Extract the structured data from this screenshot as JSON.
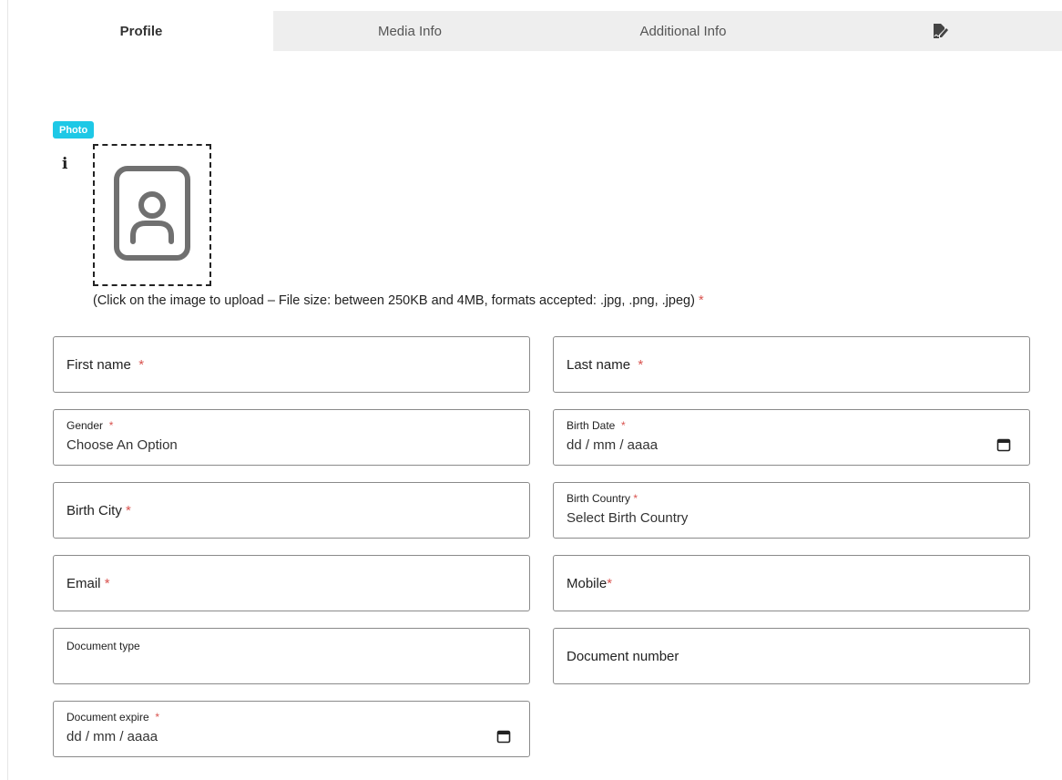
{
  "tabs": [
    {
      "label": "Profile",
      "active": true
    },
    {
      "label": "Media Info",
      "active": false
    },
    {
      "label": "Additional Info",
      "active": false
    },
    {
      "label": "",
      "icon": "signature-edit-icon",
      "active": false
    }
  ],
  "photo": {
    "badge": "Photo",
    "info_icon": "i",
    "hint": "(Click on the image to upload – File size: between 250KB and 4MB, formats accepted: .jpg, .png, .jpeg)",
    "required_mark": "*"
  },
  "fields": {
    "first_name": {
      "label": "First name",
      "required": "*"
    },
    "last_name": {
      "label": "Last name",
      "required": "*"
    },
    "gender": {
      "label": "Gender",
      "required": "*",
      "value": "Choose An Option"
    },
    "birth_date": {
      "label": "Birth Date",
      "required": "*",
      "value": "dd / mm / aaaa"
    },
    "birth_city": {
      "label": "Birth City",
      "required": "*"
    },
    "birth_country": {
      "label": "Birth Country",
      "required": "*",
      "value": "Select Birth Country"
    },
    "email": {
      "label": "Email",
      "required": "*"
    },
    "mobile": {
      "label": "Mobile",
      "required": "*"
    },
    "document_type": {
      "label": "Document type"
    },
    "document_number": {
      "label": "Document number"
    },
    "document_expire": {
      "label": "Document expire",
      "required": "*",
      "value": "dd / mm / aaaa"
    }
  },
  "colors": {
    "accent": "#1ec8e6",
    "required": "#d9534f",
    "tab_bg": "#eeeeee"
  }
}
